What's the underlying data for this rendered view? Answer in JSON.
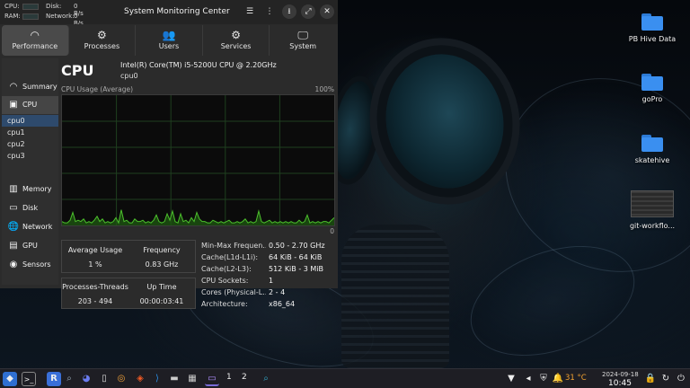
{
  "topbar": {
    "cpu_label": "CPU:",
    "ram_label": "RAM:",
    "disk_label": "Disk:",
    "disk_value": "0 B/s",
    "network_label": "Network:",
    "network_value": "0 B/s",
    "title": "System Monitoring Center",
    "icons": [
      "menu-icon",
      "more-icon",
      "download-icon",
      "expand-icon",
      "close-icon"
    ]
  },
  "tabs": [
    {
      "label": "Performance",
      "icon": "gauge-icon",
      "active": true
    },
    {
      "label": "Processes",
      "icon": "gears-icon"
    },
    {
      "label": "Users",
      "icon": "users-icon"
    },
    {
      "label": "Services",
      "icon": "services-icon"
    },
    {
      "label": "System",
      "icon": "monitor-icon"
    }
  ],
  "sidebar": {
    "summary": "Summary",
    "cpu": "CPU",
    "cpu_items": [
      "cpu0",
      "cpu1",
      "cpu2",
      "cpu3"
    ],
    "selected_cpu": "cpu0",
    "memory": "Memory",
    "disk": "Disk",
    "network": "Network",
    "gpu": "GPU",
    "sensors": "Sensors"
  },
  "cpu": {
    "title": "CPU",
    "model": "Intel(R) Core(TM) i5-5200U CPU @ 2.20GHz",
    "selected": "cpu0",
    "graph_title": "CPU Usage (Average)",
    "graph_max": "100%",
    "graph_min": "0",
    "usage_history": [
      3,
      2,
      2,
      4,
      10,
      3,
      4,
      3,
      5,
      2,
      3,
      2,
      4,
      7,
      3,
      5,
      2,
      3,
      2,
      3,
      6,
      2,
      12,
      3,
      4,
      2,
      2,
      5,
      3,
      3,
      4,
      2,
      3,
      2,
      4,
      8,
      3,
      2,
      3,
      9,
      4,
      11,
      3,
      2,
      9,
      3,
      4,
      2,
      6,
      3,
      10,
      5,
      3,
      3,
      2,
      2,
      4,
      3,
      2,
      3,
      2,
      3,
      4,
      2,
      2,
      3,
      2,
      3,
      5,
      2,
      3,
      2,
      3,
      11,
      3,
      2,
      3,
      4,
      2,
      3,
      2,
      3,
      2,
      3,
      2,
      3,
      2,
      2,
      4,
      2,
      3,
      8,
      2,
      3,
      2,
      3,
      2,
      3,
      3,
      2,
      4,
      6
    ],
    "average_usage_label": "Average Usage",
    "average_usage_value": "1 %",
    "frequency_label": "Frequency",
    "frequency_value": "0.83 GHz",
    "processes_threads_label": "Processes-Threads",
    "processes_threads_value": "203 - 494",
    "uptime_label": "Up Time",
    "uptime_value": "00:00:03:41",
    "specs": [
      {
        "key": "Min-Max Frequen...",
        "value": "0.50 - 2.70 GHz"
      },
      {
        "key": "Cache(L1d-L1i):",
        "value": "64 KiB - 64 KiB"
      },
      {
        "key": "Cache(L2-L3):",
        "value": "512 KiB - 3 MiB"
      },
      {
        "key": "CPU Sockets:",
        "value": "1"
      },
      {
        "key": "Cores (Physical-L...",
        "value": "2 - 4"
      },
      {
        "key": "Architecture:",
        "value": "x86_64"
      }
    ]
  },
  "desktop_icons": [
    {
      "label": "PB Hive Data",
      "icon": "folder-icon"
    },
    {
      "label": "goPro",
      "icon": "folder-icon"
    },
    {
      "label": "skatehive",
      "icon": "folder-icon"
    },
    {
      "label": "git-workflo...",
      "icon": "image-file-icon"
    }
  ],
  "taskbar": {
    "workspace_1": "1",
    "workspace_2": "2",
    "temperature": "31 °C",
    "date": "2024-09-18",
    "time": "10:45",
    "colors": {
      "accent": "#3a8ff0",
      "selection": "#2e4a6c",
      "graph_line": "#4cc02c",
      "graph_fill": "#1f5a12"
    }
  }
}
